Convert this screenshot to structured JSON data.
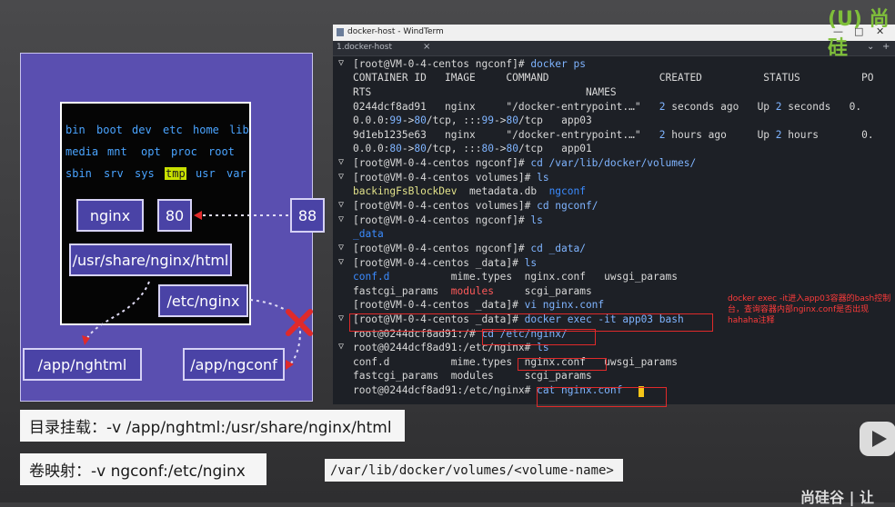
{
  "diagram": {
    "fs_dirs_row1": [
      "bin",
      "boot",
      "dev",
      "etc",
      "home",
      "lib"
    ],
    "fs_dirs_row2": [
      "media",
      "mnt",
      "opt",
      "proc",
      "root"
    ],
    "fs_dirs_row3": [
      "sbin",
      "srv",
      "sys",
      "tmp",
      "usr",
      "var"
    ],
    "nginx_label": "nginx",
    "container_port": "80",
    "host_port": "88",
    "container_html_path": "/usr/share/nginx/html",
    "container_conf_path": "/etc/nginx",
    "host_html_dir": "/app/nghtml",
    "host_conf_dir": "/app/ngconf"
  },
  "labels": {
    "bind_mount": "目录挂载：-v /app/nghtml:/usr/share/nginx/html",
    "volume_mapping": "卷映射：-v ngconf:/etc/nginx",
    "volume_path": "/var/lib/docker/volumes/<volume-name>"
  },
  "window": {
    "title": "docker-host - WindTerm",
    "tab_label": "1.docker-host",
    "tab_close": "×",
    "minimize": "—",
    "maximize": "□",
    "close": "✕",
    "tab_add": "+",
    "tab_menu": "⌄"
  },
  "terminal": {
    "prompt1": "[root@VM-0-4-centos ngconf]#",
    "cmd_docker_ps": "docker ps",
    "ps_header": "CONTAINER ID   IMAGE     COMMAND                  CREATED          STATUS          PO",
    "ps_header2": "RTS                                   NAMES",
    "row1_id": "0244dcf8ad91   nginx     \"/docker-entrypoint.…\"   ",
    "row1_num": "2",
    "row1_created": " seconds ago   Up ",
    "row1_num2": "2",
    "row1_status": " seconds   0.",
    "row1_ports_a": "0.0.0:",
    "row1_ports_b": "99",
    "row1_ports_c": "->",
    "row1_ports_d": "80",
    "row1_ports_e": "/tcp, :::",
    "row1_ports_f": "99",
    "row1_ports_g": "->",
    "row1_ports_h": "80",
    "row1_ports_i": "/tcp   app03",
    "row2_id": "9d1eb1235e63   nginx     \"/docker-entrypoint.…\"   ",
    "row2_num": "2",
    "row2_created": " hours ago     Up ",
    "row2_num2": "2",
    "row2_status": " hours       0.",
    "row2_ports_a": "0.0.0:",
    "row2_ports_b": "80",
    "row2_ports_c": "->",
    "row2_ports_d": "80",
    "row2_ports_e": "/tcp, :::",
    "row2_ports_f": "80",
    "row2_ports_g": "->",
    "row2_ports_h": "80",
    "row2_ports_i": "/tcp   app01",
    "prompt_cd_volumes": "[root@VM-0-4-centos ngconf]# ",
    "cmd_cd_volumes": "cd /var/lib/docker/volumes/",
    "prompt_ls1": "[root@VM-0-4-centos volumes]# ",
    "cmd_ls": "ls",
    "ls1_a": "backingFsBlockDev",
    "ls1_b": "  metadata.db  ",
    "ls1_c": "ngconf",
    "prompt_cd_ngconf": "[root@VM-0-4-centos volumes]# ",
    "cmd_cd_ngconf": "cd ngconf/",
    "prompt_ls2": "[root@VM-0-4-centos ngconf]# ",
    "ls2": "_data",
    "prompt_cd_data": "[root@VM-0-4-centos ngconf]# ",
    "cmd_cd_data": "cd _data/",
    "prompt_ls3": "[root@VM-0-4-centos _data]# ",
    "ls3_a": "conf.d",
    "ls3_b": "          mime.types  nginx.conf   uwsgi_params",
    "ls3_c": "fastcgi_params  ",
    "ls3_d": "modules",
    "ls3_e": "     scgi_params",
    "prompt_vi": "[root@VM-0-4-centos _data]# ",
    "cmd_vi": "vi nginx.conf",
    "prompt_exec": "[root@VM-0-4-centos _data]# ",
    "cmd_exec": "docker exec -it app03 bash",
    "prompt_c1": "root@0244dcf8ad91:/# ",
    "cmd_cd_etc": "cd /etc/nginx/",
    "prompt_c2": "root@0244dcf8ad91:/etc/nginx# ",
    "c_ls_a": "conf.d          mime.types  nginx.conf   uwsgi_params",
    "c_ls_b": "fastcgi_params  modules     scgi_params",
    "prompt_c3": "root@0244dcf8ad91:/etc/nginx# ",
    "cmd_cat": "cat nginx.conf"
  },
  "annotation": {
    "note": "docker exec -it进入app03容器的bash控制台，查询容器内部nginx.conf是否出现hahaha注释"
  },
  "branding": {
    "logo": "(U) 尚硅",
    "footer": "尚硅谷 | 让"
  }
}
